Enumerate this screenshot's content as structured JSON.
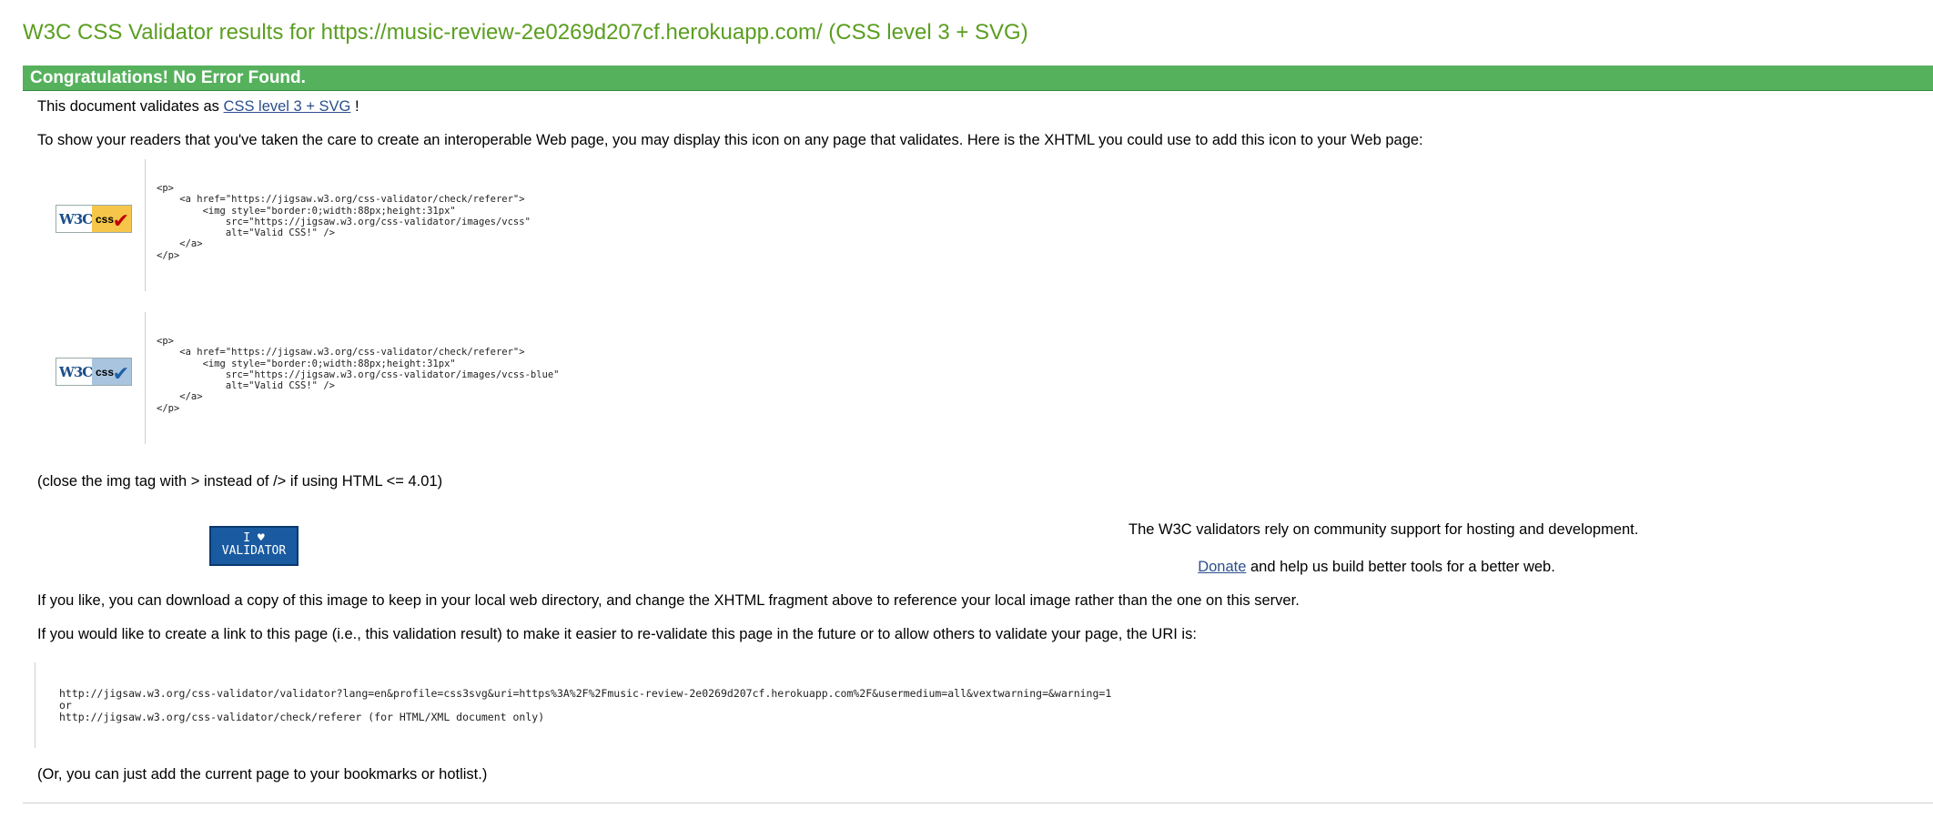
{
  "page": {
    "title": "W3C CSS Validator results for https://music-review-2e0269d207cf.herokuapp.com/ (CSS level 3 + SVG)",
    "banner": "Congratulations! No Error Found."
  },
  "validates": {
    "prefix": "This document validates as",
    "link": "CSS level 3 + SVG",
    "suffix": "!"
  },
  "intro_text": "To show your readers that you've taken the care to create an interoperable Web page, you may display this icon on any page that validates. Here is the XHTML you could use to add this icon to your Web page:",
  "badges": [
    {
      "w3c": "W3C",
      "css": "css",
      "check": "✔",
      "code": "<p>\n    <a href=\"https://jigsaw.w3.org/css-validator/check/referer\">\n        <img style=\"border:0;width:88px;height:31px\"\n            src=\"https://jigsaw.w3.org/css-validator/images/vcss\"\n            alt=\"Valid CSS!\" />\n    </a>\n</p>"
    },
    {
      "w3c": "W3C",
      "css": "css",
      "check": "✔",
      "code": "<p>\n    <a href=\"https://jigsaw.w3.org/css-validator/check/referer\">\n        <img style=\"border:0;width:88px;height:31px\"\n            src=\"https://jigsaw.w3.org/css-validator/images/vcss-blue\"\n            alt=\"Valid CSS!\" />\n    </a>\n</p>"
    }
  ],
  "close_note": "(close the img tag with > instead of /> if using HTML <= 4.01)",
  "validator_badge": {
    "line1": "I ♥",
    "line2": "VALIDATOR"
  },
  "donate": {
    "text": "The W3C validators rely on community support for hosting and development.",
    "link": "Donate",
    "after": "and help us build better tools for a better web."
  },
  "download_text": "If you like, you can download a copy of this image to keep in your local web directory, and change the XHTML fragment above to reference your local image rather than the one on this server.",
  "link_text": "If you would like to create a link to this page (i.e., this validation result) to make it easier to re-validate this page in the future or to allow others to validate your page, the URI is:",
  "uri_block": "http://jigsaw.w3.org/css-validator/validator?lang=en&profile=css3svg&uri=https%3A%2F%2Fmusic-review-2e0269d207cf.herokuapp.com%2F&usermedium=all&vextwarning=&warning=1\nor\nhttp://jigsaw.w3.org/css-validator/check/referer (for HTML/XML document only)",
  "bookmark_note": "(Or, you can just add the current page to your bookmarks or hotlist.)"
}
